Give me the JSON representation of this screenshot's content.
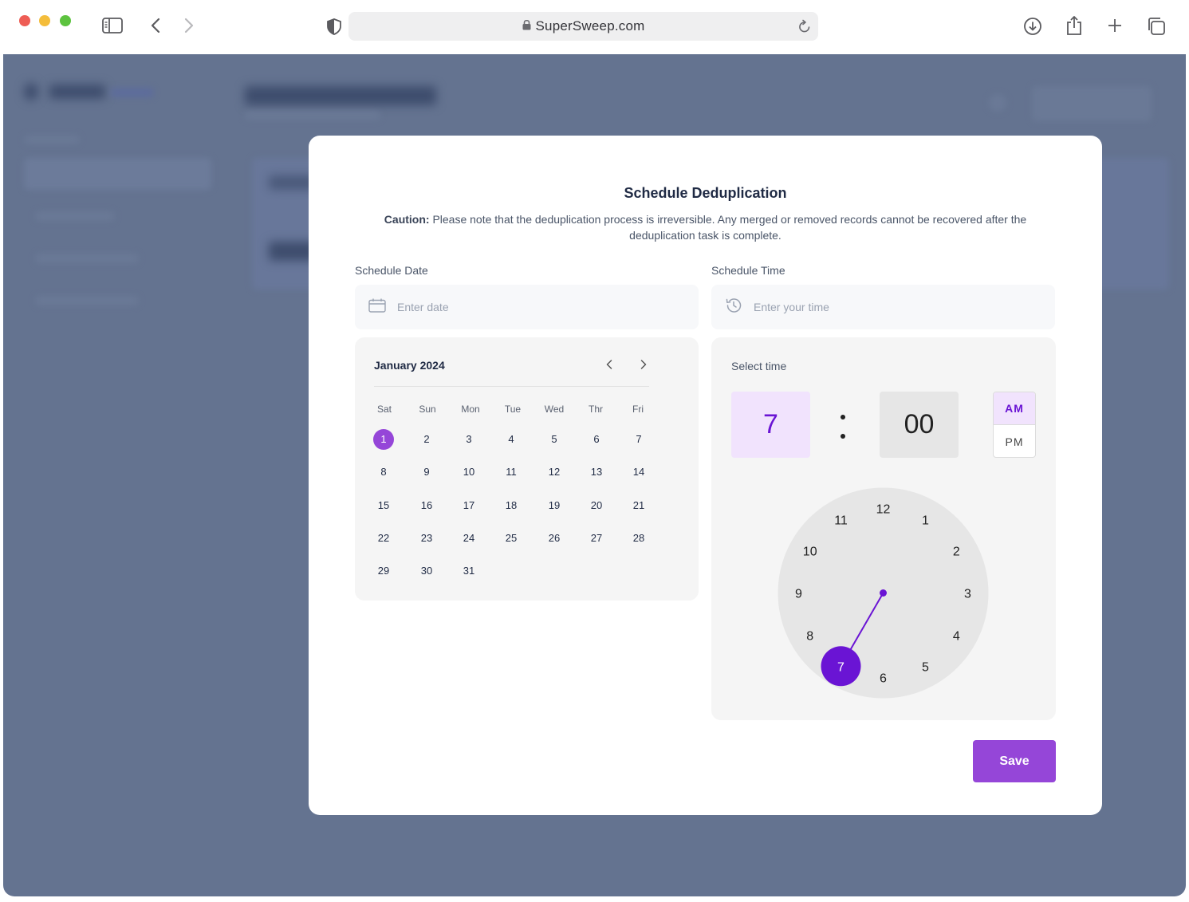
{
  "browser": {
    "url": "SuperSweep.com"
  },
  "modal": {
    "title": "Schedule Deduplication",
    "caution_label": "Caution:",
    "caution_text": " Please note that the deduplication process is irreversible. Any merged or removed records cannot be recovered after the deduplication task is complete.",
    "date_label": "Schedule Date",
    "date_placeholder": "Enter date",
    "time_label": "Schedule Time",
    "time_placeholder": "Enter your time",
    "save_label": "Save"
  },
  "calendar": {
    "month": "January 2024",
    "weekdays": [
      "Sat",
      "Sun",
      "Mon",
      "Tue",
      "Wed",
      "Thr",
      "Fri"
    ],
    "days": [
      "1",
      "2",
      "3",
      "4",
      "5",
      "6",
      "7",
      "8",
      "9",
      "10",
      "11",
      "12",
      "13",
      "14",
      "15",
      "16",
      "17",
      "18",
      "19",
      "20",
      "21",
      "22",
      "23",
      "24",
      "25",
      "26",
      "27",
      "28",
      "29",
      "30",
      "31"
    ],
    "selected_day": "1"
  },
  "timepicker": {
    "label": "Select time",
    "hour": "7",
    "minute": "00",
    "am_label": "AM",
    "pm_label": "PM",
    "period": "AM",
    "clock_numbers": [
      "12",
      "1",
      "2",
      "3",
      "4",
      "5",
      "6",
      "7",
      "8",
      "9",
      "10",
      "11"
    ],
    "accent": "#6a14d4"
  },
  "colors": {
    "accent": "#9546d8",
    "accent_dark": "#6a14d4",
    "overlay": "#647390"
  }
}
